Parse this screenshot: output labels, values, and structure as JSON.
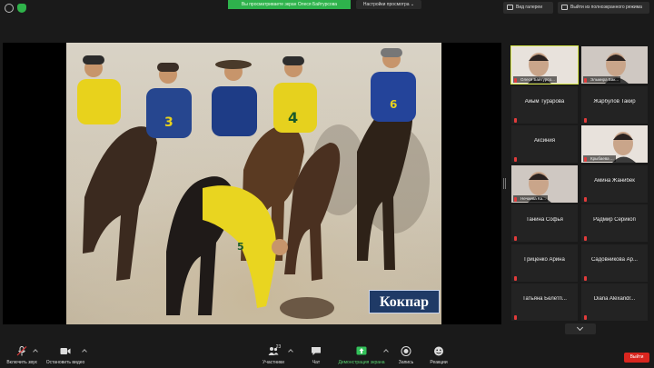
{
  "topbar": {
    "share_banner": "Вы просматриваете экран Олеся Байтурсова",
    "view_settings": "Настройки просмотра ⌄",
    "gallery_view": "Вид галереи",
    "exit_fullscreen": "Выйти из полноэкранного режима"
  },
  "slide": {
    "caption": "Кокпар"
  },
  "participants": [
    {
      "name": "Олеся Байтурсова",
      "label": "Олеся Байтурсо...",
      "video": true,
      "active": true
    },
    {
      "name": "Эльмира Бак...",
      "label": "Эльмира Бак...",
      "video": true,
      "active": false
    },
    {
      "name": "Айым Турарова",
      "label": "",
      "video": false
    },
    {
      "name": "Жарбулов Такир",
      "label": "",
      "video": false
    },
    {
      "name": "Аксиния",
      "label": "",
      "video": false
    },
    {
      "name": "Крыбаева ...",
      "label": "Крыбаева ...",
      "video": true
    },
    {
      "name": "Нечаева Ка...",
      "label": "Нечаева Ка...",
      "video": true
    },
    {
      "name": "Амина Жанибек",
      "label": "",
      "video": false
    },
    {
      "name": "Танина Софья",
      "label": "",
      "video": false
    },
    {
      "name": "Радмир Серикоп",
      "label": "",
      "video": false
    },
    {
      "name": "Гриценко Арина",
      "label": "",
      "video": false
    },
    {
      "name": "Садовникова Ар...",
      "label": "",
      "video": false
    },
    {
      "name": "Татьяна Белетп...",
      "label": "",
      "video": false
    },
    {
      "name": "Diana Alexandr...",
      "label": "",
      "video": false
    }
  ],
  "toolbar": {
    "unmute": "Включить звук",
    "stop_video": "Остановить видео",
    "participants": "Участники",
    "participants_count": "23",
    "chat": "Чат",
    "share_screen": "Демонстрация экрана",
    "record": "Запись",
    "reactions": "Реакции",
    "end": "Выйти"
  },
  "colors": {
    "banner_green": "#2eb24c",
    "end_red": "#d9261f",
    "active_speaker": "#d8e84a",
    "caption_bg": "#1f3a66"
  }
}
